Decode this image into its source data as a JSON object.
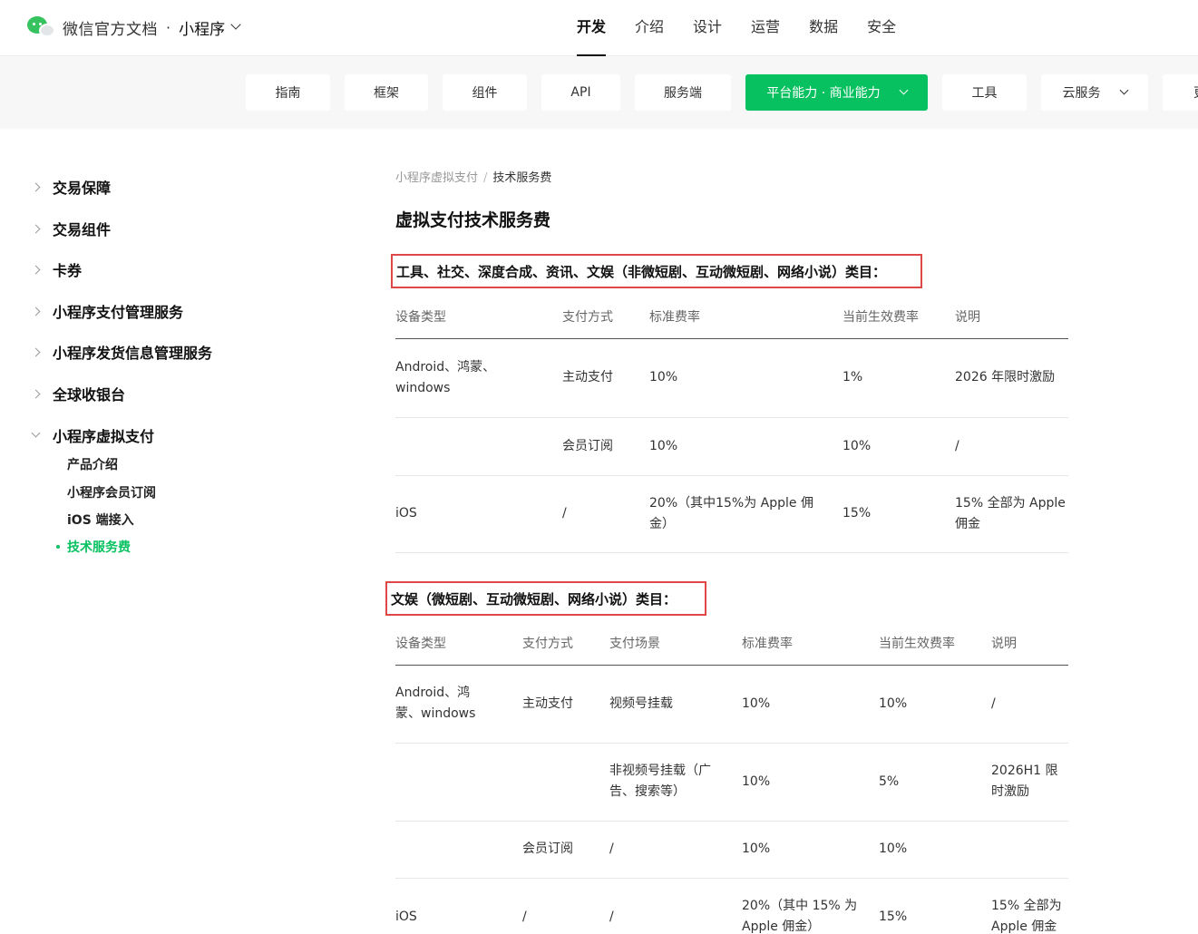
{
  "header": {
    "brand_title": "微信官方文档",
    "brand_dot": "·",
    "brand_sub": "小程序",
    "nav": [
      "开发",
      "介绍",
      "设计",
      "运营",
      "数据",
      "安全"
    ],
    "active_nav": "开发"
  },
  "subnav": {
    "items": [
      "指南",
      "框架",
      "组件",
      "API",
      "服务端",
      "平台能力 · 商业能力",
      "工具",
      "云服务",
      "更"
    ],
    "active": "平台能力 · 商业能力"
  },
  "sidebar": {
    "items": [
      "交易保障",
      "交易组件",
      "卡券",
      "小程序支付管理服务",
      "小程序发货信息管理服务",
      "全球收银台",
      "小程序虚拟支付"
    ],
    "subitems": [
      "产品介绍",
      "小程序会员订阅",
      "iOS 端接入",
      "技术服务费"
    ],
    "active_subitem": "技术服务费"
  },
  "breadcrumb": {
    "parent": "小程序虚拟支付",
    "sep": "/",
    "current": "技术服务费"
  },
  "page_title": "虚拟支付技术服务费",
  "section1": {
    "title": "工具、社交、深度合成、资讯、文娱（非微短剧、互动微短剧、网络小说）类目：",
    "headers": [
      "设备类型",
      "支付方式",
      "标准费率",
      "当前生效费率",
      "说明"
    ],
    "rows": [
      [
        "Android、鸿蒙、windows",
        "主动支付",
        "10%",
        "1%",
        "2026 年限时激励"
      ],
      [
        "",
        "会员订阅",
        "10%",
        "10%",
        "/"
      ],
      [
        "iOS",
        "/",
        "20%（其中15%为 Apple 佣金）",
        "15%",
        "15% 全部为 Apple 佣金"
      ]
    ]
  },
  "section2": {
    "title": "文娱（微短剧、互动微短剧、网络小说）类目：",
    "headers": [
      "设备类型",
      "支付方式",
      "支付场景",
      "标准费率",
      "当前生效费率",
      "说明"
    ],
    "rows": [
      [
        "Android、鸿蒙、windows",
        "主动支付",
        "视频号挂载",
        "10%",
        "10%",
        "/"
      ],
      [
        "",
        "",
        "非视频号挂载（广告、搜索等）",
        "10%",
        "5%",
        "2026H1 限时激励"
      ],
      [
        "",
        "会员订阅",
        "/",
        "10%",
        "10%",
        ""
      ],
      [
        "iOS",
        "/",
        "/",
        "20%（其中 15% 为 Apple 佣金）",
        "15%",
        "15% 全部为 Apple 佣金"
      ]
    ]
  },
  "colors": {
    "accent": "#07c160",
    "highlight_border": "#e04848"
  },
  "icons": [
    "wechat-logo-icon",
    "chevron-down-icon",
    "chevron-right-icon"
  ]
}
